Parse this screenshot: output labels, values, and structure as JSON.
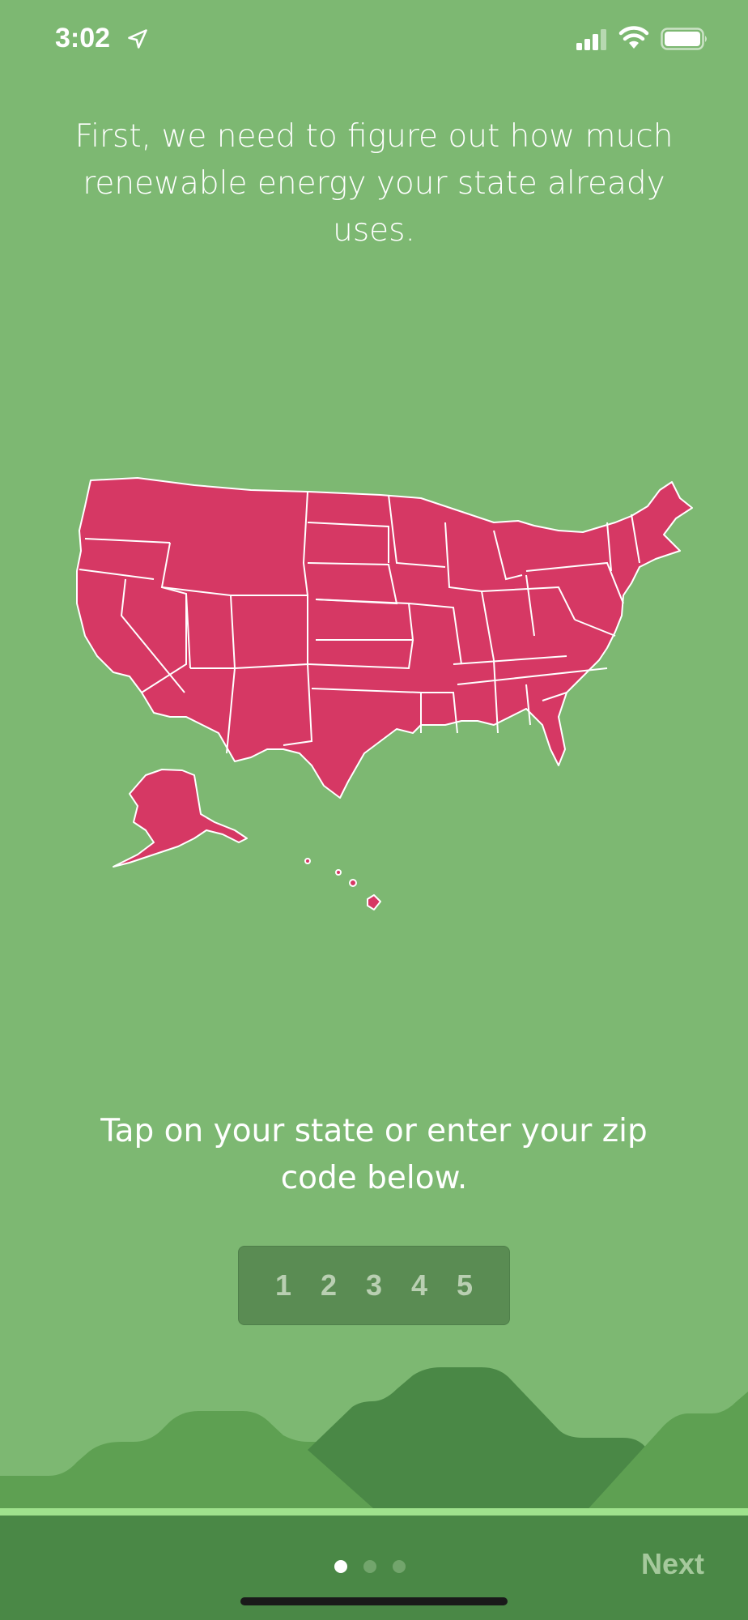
{
  "status": {
    "time": "3:02"
  },
  "headline": "First, we need to figure out how much renewable energy your state already uses.",
  "instruction": "Tap on your state or enter your zip code below.",
  "zip": {
    "digits": [
      "1",
      "2",
      "3",
      "4",
      "5"
    ]
  },
  "navigation": {
    "next_label": "Next",
    "page_count": 3,
    "current_page": 1
  },
  "colors": {
    "background": "#7db872",
    "map_fill": "#d63864",
    "bottom_bar": "#4a8846",
    "accent_line": "#9fe28d"
  },
  "icons": [
    "location-arrow-icon",
    "cellular-signal-icon",
    "wifi-icon",
    "battery-icon"
  ]
}
